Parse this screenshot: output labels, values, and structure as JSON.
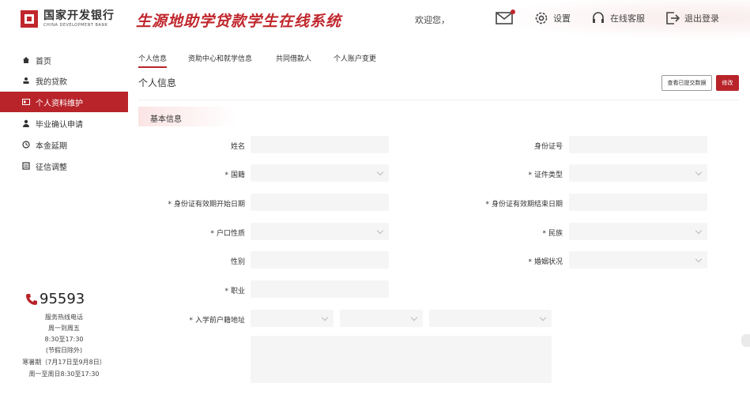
{
  "header": {
    "logo_cn": "国家开发银行",
    "logo_en": "CHINA DEVELOPMENT BANK",
    "system_title": "生源地助学贷款学生在线系统",
    "welcome": "欢迎您，",
    "settings": "设置",
    "service": "在线客服",
    "logout": "退出登录",
    "mail_icon": "mail-icon",
    "settings_icon": "gear-icon",
    "service_icon": "headset-icon",
    "logout_icon": "logout-icon"
  },
  "sidebar": {
    "items": [
      {
        "label": "首页",
        "icon": "home-icon"
      },
      {
        "label": "我的贷款",
        "icon": "loan-icon"
      },
      {
        "label": "个人资料维护",
        "icon": "id-card-icon"
      },
      {
        "label": "毕业确认申请",
        "icon": "user-icon"
      },
      {
        "label": "本金延期",
        "icon": "clock-icon"
      },
      {
        "label": "征信调整",
        "icon": "list-icon"
      }
    ],
    "active_index": 2,
    "hotline": "95593",
    "lines": [
      "服务热线电话",
      "周一到周五",
      "8:30至17:30",
      "(节假日除外)",
      "寒暑期（7月17日至9月8日）",
      "周一至周日8:30至17:30"
    ]
  },
  "main": {
    "tabs": [
      "个人信息",
      "资助中心和就学信息",
      "共同借款人",
      "个人账户变更"
    ],
    "active_tab": 0,
    "page_title": "个人信息",
    "btn_view_submitted": "查看已提交数据",
    "btn_edit": "修改",
    "section_title": "基本信息",
    "fields": {
      "name": "姓名",
      "id_number": "身份证号",
      "nationality": "国籍",
      "id_type": "证件类型",
      "id_start": "身份证有效期开始日期",
      "id_end": "身份证有效期结束日期",
      "hukou": "户口性质",
      "ethnicity": "民族",
      "gender": "性别",
      "marital": "婚姻状况",
      "occupation": "职业",
      "address": "入学前户籍地址"
    },
    "required_mark": "*"
  },
  "colors": {
    "accent": "#b8242a",
    "field_bg": "#f5f5f5"
  }
}
